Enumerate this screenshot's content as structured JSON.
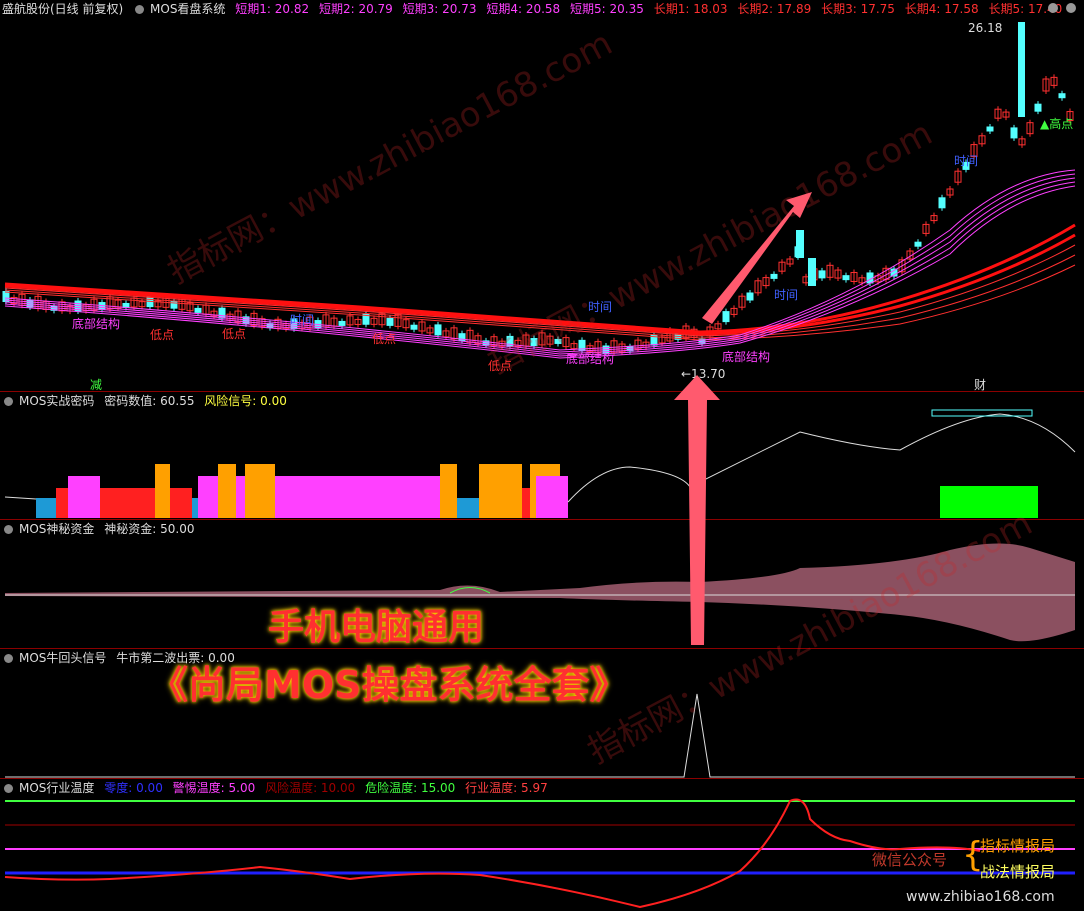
{
  "header": {
    "title": "盛航股份(日线 前复权)",
    "indicator": "MOS看盘系统",
    "short_terms": [
      "短期1: 20.82",
      "短期2: 20.79",
      "短期3: 20.73",
      "短期4: 20.58",
      "短期5: 20.35"
    ],
    "long_terms": [
      "长期1: 18.03",
      "长期2: 17.89",
      "长期3: 17.75",
      "长期4: 17.58",
      "长期5: 17.40"
    ]
  },
  "main_chart": {
    "high_label": "26.18",
    "low_label": "←13.70",
    "high_point_label": "▲高点",
    "bottom_labels": [
      "底部结构",
      "底部结构",
      "底部结构"
    ],
    "low_point_labels": [
      "低点",
      "低点",
      "低点",
      "低点"
    ],
    "time_labels": [
      "时间",
      "时间",
      "时间",
      "时间"
    ],
    "reduce_label": "减",
    "finance_label": "财"
  },
  "pane2": {
    "name": "MOS实战密码",
    "value_text": "密码数值: 60.55",
    "risk_text": "风险信号: 0.00"
  },
  "pane3": {
    "name": "MOS神秘资金",
    "value_text": "神秘资金: 50.00"
  },
  "pane4": {
    "name": "MOS牛回头信号",
    "value_text": "牛市第二波出票: 0.00"
  },
  "pane5": {
    "name": "MOS行业温度",
    "items": [
      {
        "text": "零度: 0.00",
        "color": "#3030ff"
      },
      {
        "text": "警惕温度: 5.00",
        "color": "#ff40ff"
      },
      {
        "text": "风险温度: 10.00",
        "color": "#a00000"
      },
      {
        "text": "危险温度: 15.00",
        "color": "#40ff40"
      },
      {
        "text": "行业温度: 5.97",
        "color": "#ff4040"
      }
    ]
  },
  "promo": {
    "line1": "手机电脑通用",
    "line2": "《尚局MOS操盘系统全套》"
  },
  "watermarks": [
    "指标网：www.zhibiao168.com",
    "指标网：www.zhibiao168.com",
    "指标网：www.zhibiao168.com"
  ],
  "footer": {
    "wechat": "微信公众号",
    "brace": "{",
    "item1": "指标情报局",
    "item2": "战法情报局",
    "url": "www.zhibiao168.com"
  },
  "colors": {
    "up": "#ff3030",
    "down": "#54ffff",
    "ma_short": "#ff40ff",
    "ma_long": "#ff2020",
    "bg": "#000000"
  }
}
